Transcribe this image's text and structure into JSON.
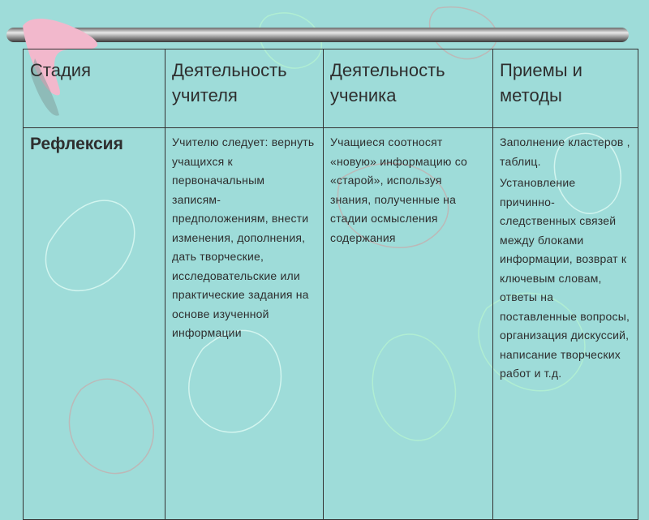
{
  "table": {
    "headers": [
      "Стадия",
      "Деятельность учителя",
      "Деятельность ученика",
      "Приемы и методы"
    ],
    "row": {
      "stage": "Рефлексия",
      "teacher": "Учителю следует: вернуть учащихся к первоначальным записям-предположениям, внести изменения, дополнения, дать творческие, исследовательские или практические задания на основе изученной информации",
      "student": "Учащиеся соотносят «новую» информацию со «старой», используя знания, полученные на стадии осмысления содержания",
      "methods_1": "Заполнение кластеров , таблиц.",
      "methods_2": "Установление причинно-следственных связей между блоками информации, возврат к ключевым словам, ответы на поставленные вопросы, организация дискуссий, написание творческих работ и т.д."
    }
  },
  "colors": {
    "background": "#9edcd9",
    "boomerang": "#f2b8cc",
    "text": "#2e2e2e"
  }
}
